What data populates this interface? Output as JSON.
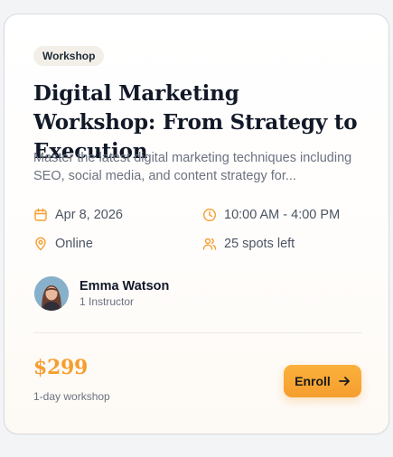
{
  "card": {
    "tag": "Workshop",
    "title": "Digital Marketing Workshop: From Strategy to Execution",
    "description": "Master the latest digital marketing techniques including SEO, social media, and content strategy for...",
    "meta": {
      "date": "Apr 8, 2026",
      "time": "10:00 AM - 4:00 PM",
      "location": "Online",
      "spots": "25 spots left"
    },
    "instructor": {
      "name": "Emma Watson",
      "role": "1 Instructor"
    },
    "price": "$299",
    "duration": "1-day workshop",
    "enroll_label": "Enroll"
  },
  "icons": {
    "date": "calendar-icon",
    "time": "clock-icon",
    "location": "map-pin-icon",
    "spots": "users-icon",
    "enroll": "arrow-right-icon"
  },
  "colors": {
    "accent": "#f59e2f",
    "tag_bg": "#f2efe8",
    "title": "#111827",
    "muted": "#6b7280"
  }
}
